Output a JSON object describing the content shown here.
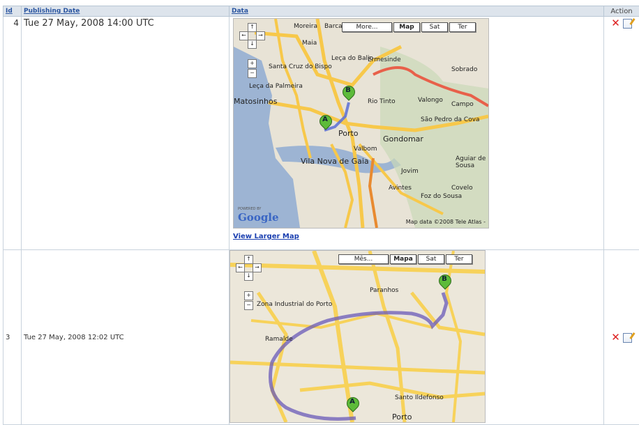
{
  "table": {
    "headers": {
      "id": "Id",
      "publishing_date": "Publishing Date",
      "data": "Data",
      "action": "Action"
    },
    "rows": [
      {
        "id": "4",
        "date": "Tue 27 May, 2008 14:00 UTC",
        "map": {
          "type_buttons": [
            "More...",
            "Map",
            "Sat",
            "Ter"
          ],
          "active": "Map",
          "places": [
            "Maia",
            "Barca",
            "Moreira",
            "Leça do Balio",
            "Ermesinde",
            "Sobrado",
            "Santa Cruz do Bispo",
            "Leça da Palmeira",
            "Matosinhos",
            "Rio Tinto",
            "Valongo",
            "Campo",
            "São Pedro da Cova",
            "Porto",
            "Gondomar",
            "Vila Nova de Gaia",
            "Avintes",
            "Foz do Sousa",
            "Covelo",
            "Aguiar de Sousa",
            "Valbom",
            "Jovim"
          ],
          "markers": [
            "A",
            "B"
          ],
          "powered_by": "POWERED BY",
          "logo": "Google",
          "attribution": "Map data ©2008 Tele Atlas -"
        },
        "view_larger": "View Larger Map",
        "actions": {
          "delete_icon": "delete-x-icon",
          "edit_icon": "edit-document-icon"
        }
      },
      {
        "id": "3",
        "date": "Tue 27 May, 2008 12:02 UTC",
        "map": {
          "type_buttons": [
            "Mês...",
            "Mapa",
            "Sat",
            "Ter"
          ],
          "active": "Mapa",
          "places": [
            "Paranhos",
            "Zona Industrial do Porto",
            "Ramalde",
            "Porto",
            "Santo Ildefonso"
          ],
          "markers": [
            "A",
            "B"
          ]
        },
        "actions": {
          "delete_icon": "delete-x-icon",
          "edit_icon": "edit-document-icon"
        }
      }
    ]
  },
  "colors": {
    "header_bg": "#dde4ec",
    "link": "#1a3fb0",
    "route": "#5b6fd6",
    "highway": "#f7c84a",
    "marker": "#5dbb3a"
  }
}
